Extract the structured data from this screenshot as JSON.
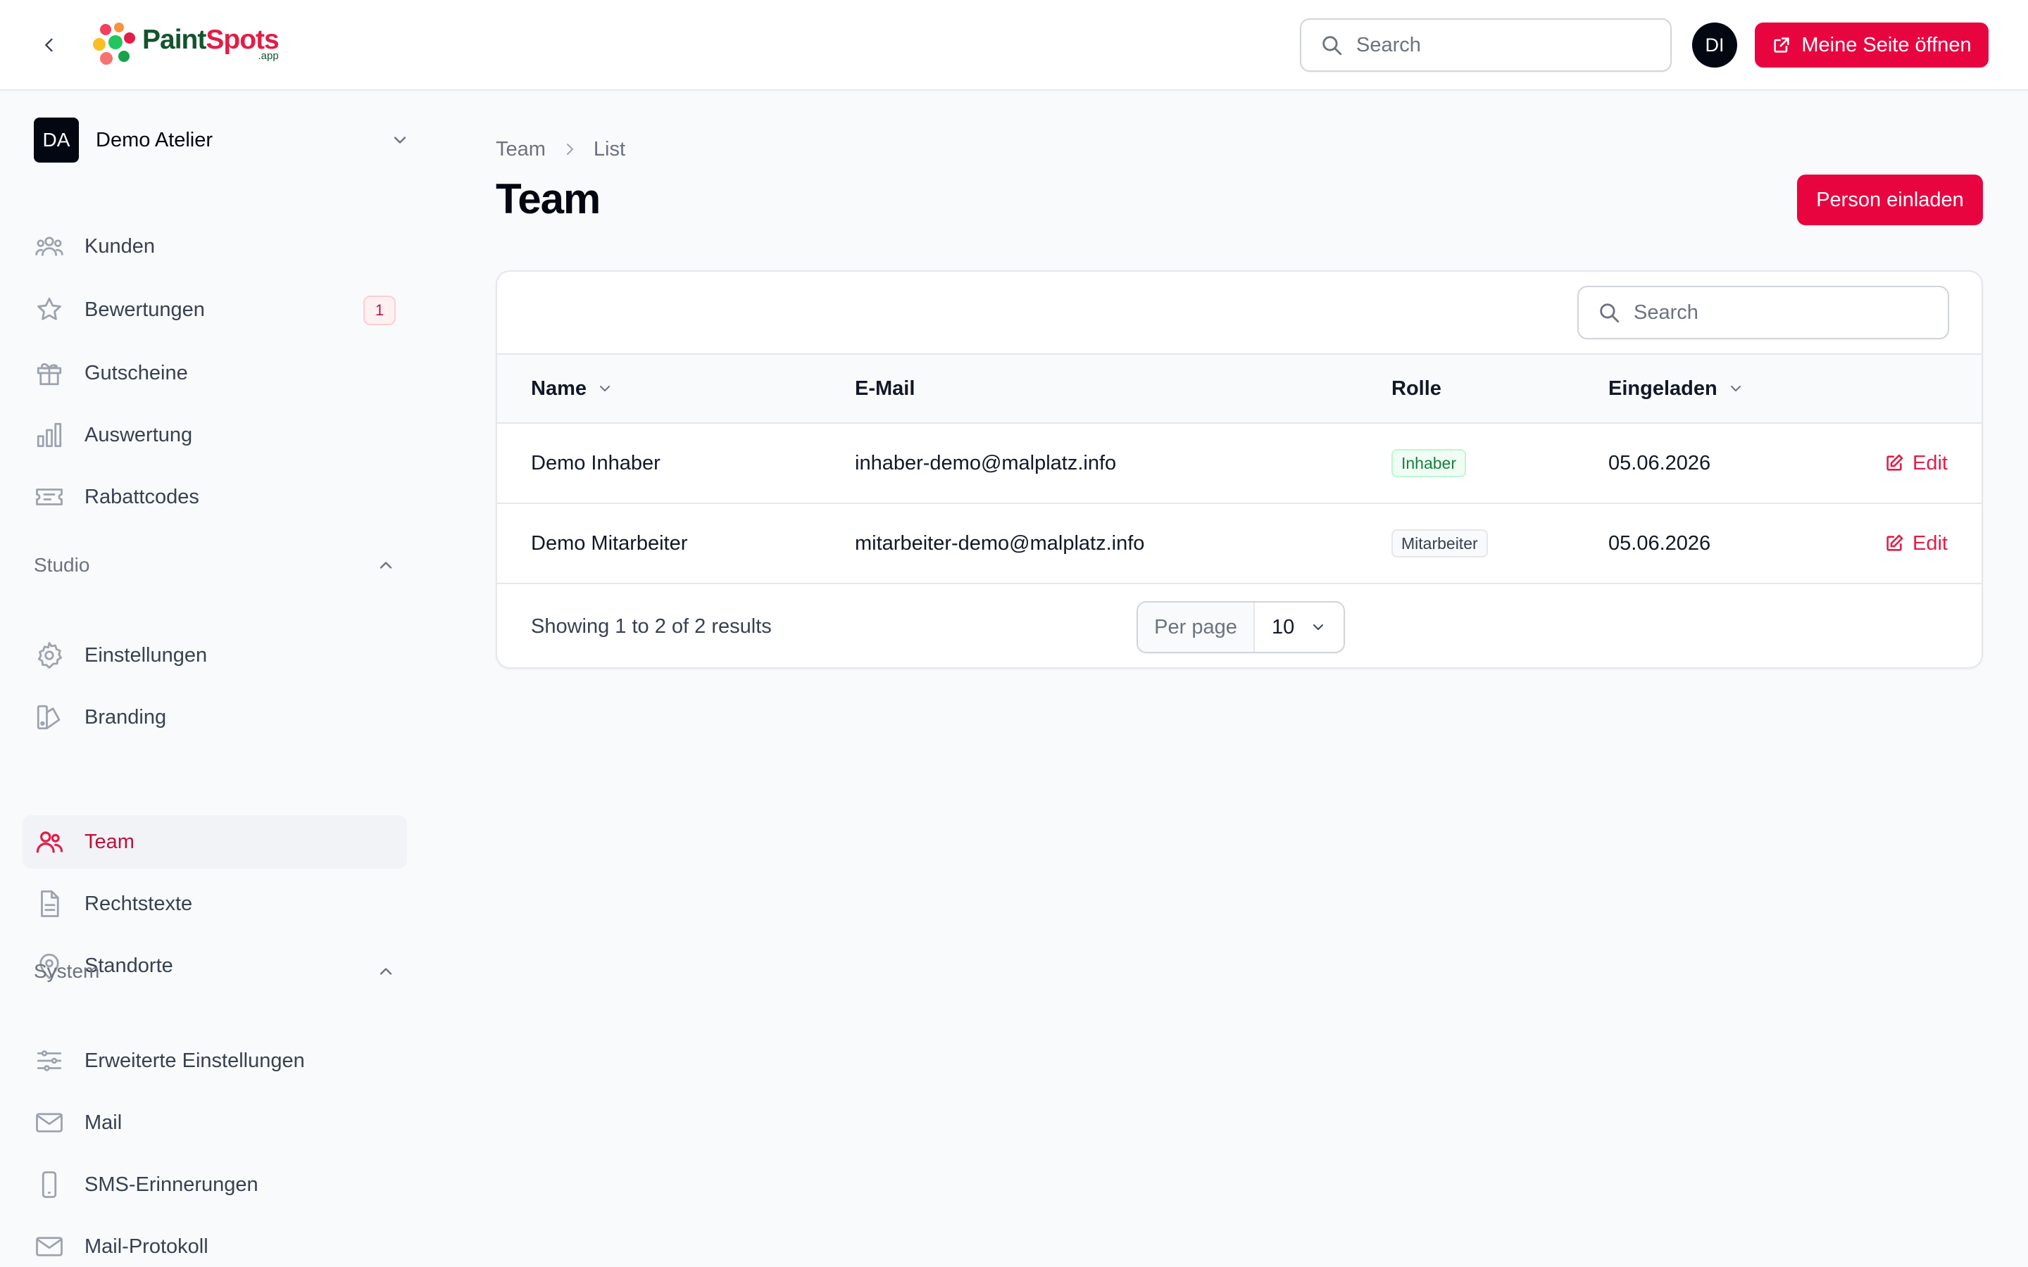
{
  "header": {
    "logo_text_a": "Paint",
    "logo_text_b": "Spots",
    "logo_sub": ".app",
    "search_placeholder": "Search",
    "user_initials": "DI",
    "open_site_label": "Meine Seite öffnen"
  },
  "tenant": {
    "initials": "DA",
    "name": "Demo Atelier"
  },
  "sidebar": {
    "main_items": [
      {
        "label": "Kunden",
        "icon": "users-icon"
      },
      {
        "label": "Bewertungen",
        "icon": "star-icon",
        "badge": "1"
      },
      {
        "label": "Gutscheine",
        "icon": "gift-icon"
      },
      {
        "label": "Auswertung",
        "icon": "chart-bar-icon"
      },
      {
        "label": "Rabattcodes",
        "icon": "ticket-icon"
      }
    ],
    "studio_group": {
      "label": "Studio",
      "items": [
        {
          "label": "Einstellungen",
          "icon": "gear-icon"
        },
        {
          "label": "Branding",
          "icon": "swatch-icon"
        },
        {
          "label": "Team",
          "icon": "users-icon",
          "active": true
        },
        {
          "label": "Rechtstexte",
          "icon": "document-icon"
        },
        {
          "label": "Standorte",
          "icon": "map-pin-icon"
        }
      ]
    },
    "system_group": {
      "label": "System",
      "items": [
        {
          "label": "Erweiterte Einstellungen",
          "icon": "sliders-icon"
        },
        {
          "label": "Mail",
          "icon": "envelope-icon"
        },
        {
          "label": "SMS-Erinnerungen",
          "icon": "phone-icon"
        },
        {
          "label": "Mail-Protokoll",
          "icon": "envelope-icon"
        }
      ]
    }
  },
  "breadcrumb": [
    "Team",
    "List"
  ],
  "page": {
    "title": "Team",
    "invite_label": "Person einladen"
  },
  "table": {
    "search_placeholder": "Search",
    "columns": [
      "Name",
      "E-Mail",
      "Rolle",
      "Eingeladen"
    ],
    "rows": [
      {
        "name": "Demo Inhaber",
        "email": "inhaber-demo@malplatz.info",
        "role": "Inhaber",
        "invited": "05.06.2026",
        "action": "Edit"
      },
      {
        "name": "Demo Mitarbeiter",
        "email": "mitarbeiter-demo@malplatz.info",
        "role": "Mitarbeiter",
        "invited": "05.06.2026",
        "action": "Edit"
      }
    ],
    "result_text": "Showing 1 to 2 of 2 results",
    "per_page_label": "Per page",
    "per_page_value": "10"
  },
  "colors": {
    "accent": "#e8053f",
    "active_text": "#be123c",
    "success": "#15803d"
  }
}
